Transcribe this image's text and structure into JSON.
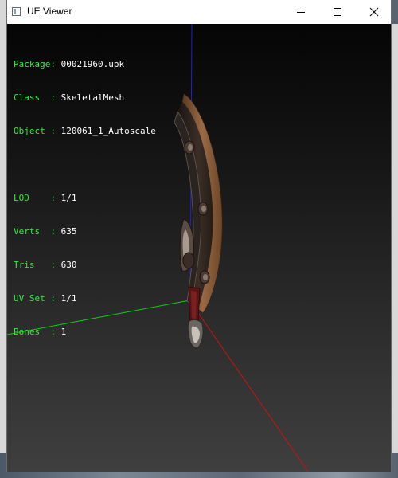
{
  "window": {
    "title": "UE Viewer"
  },
  "info": {
    "package_label": "Package",
    "package_value": "00021960.upk",
    "class_label": "Class  ",
    "class_value": "SkeletalMesh",
    "object_label": "Object ",
    "object_value": "120061_1_Autoscale",
    "lod_label": "LOD    ",
    "lod_value": "1/1",
    "verts_label": "Verts  ",
    "verts_value": "635",
    "tris_label": "Tris   ",
    "tris_value": "630",
    "uvset_label": "UV Set ",
    "uvset_value": "1/1",
    "bones_label": "Bones  ",
    "bones_value": "1"
  },
  "colors": {
    "label": "#3fe63f",
    "value": "#ffffff",
    "axis_x": "#d01010",
    "axis_y": "#10d010",
    "axis_z": "#2020d0"
  },
  "icons": {
    "app": "app-window-icon",
    "minimize": "minimize-icon",
    "maximize": "maximize-icon",
    "close": "close-icon"
  }
}
